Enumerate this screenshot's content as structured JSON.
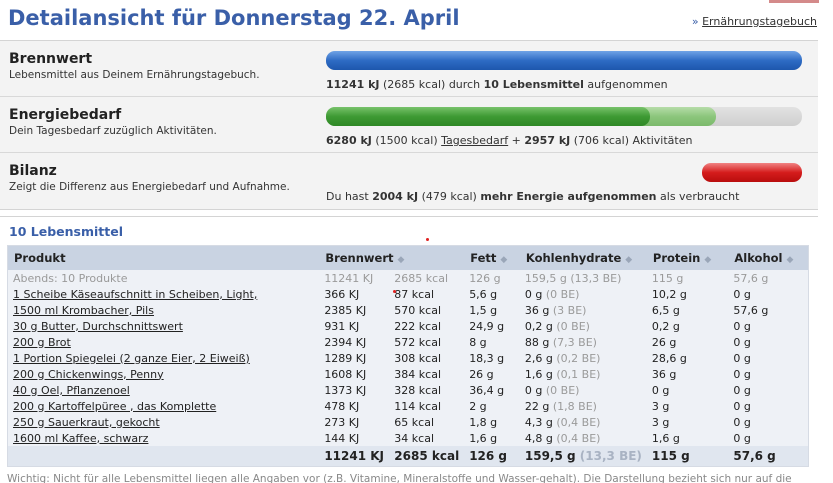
{
  "header": {
    "title": "Detailansicht für Donnerstag 22. April",
    "link_prefix": "»",
    "link_label": "Ernährungstagebuch"
  },
  "summary": {
    "brennwert": {
      "title": "Brennwert",
      "subtitle": "Lebensmittel aus Deinem Ernährungstagebuch.",
      "kj": "11241 kJ",
      "kcal": "(2685 kcal)",
      "mid": "durch",
      "count": "10 Lebensmittel",
      "suffix": "aufgenommen",
      "fill_percent": 100
    },
    "energiebedarf": {
      "title": "Energiebedarf",
      "subtitle": "Dein Tagesbedarf zuzüglich Aktivitäten.",
      "kj1": "6280 kJ",
      "kcal1": "(1500 kcal)",
      "link": "Tagesbedarf",
      "plus": "+",
      "kj2": "2957 kJ",
      "kcal2": "(706 kcal)",
      "suffix": "Aktivitäten",
      "fill_percent": 82,
      "dark_percent": 68
    },
    "bilanz": {
      "title": "Bilanz",
      "subtitle": "Zeigt die Differenz aus Energiebedarf und Aufnahme.",
      "prefix": "Du hast",
      "kj": "2004 kJ",
      "kcal": "(479 kcal)",
      "bold": "mehr Energie aufgenommen",
      "suffix": "als verbraucht",
      "fill_percent": 21
    }
  },
  "colors": {
    "title_blue": "#3a5fa8",
    "bar_blue": "#2e6bc4",
    "bar_green": "#3e9a33",
    "bar_red": "#d51c1c",
    "table_header": "#c9d3e2"
  },
  "list": {
    "title": "10 Lebensmittel",
    "columns": {
      "produkt": "Produkt",
      "brennwert": "Brennwert",
      "fett": "Fett",
      "kohlenhydrate": "Kohlenhydrate",
      "protein": "Protein",
      "alkohol": "Alkohol"
    },
    "group": {
      "name": "Abends: 10 Produkte",
      "kj": "11241 KJ",
      "kcal": "2685 kcal",
      "fett": "126 g",
      "kh": "159,5 g (13,3 BE)",
      "protein": "115 g",
      "alkohol": "57,6 g"
    },
    "rows": [
      {
        "name": "1 Scheibe Käseaufschnitt in Scheiben, Light,",
        "kj": "366 KJ",
        "kcal": "87 kcal",
        "fett": "5,6 g",
        "kh": "0 g",
        "be": "(0 BE)",
        "protein": "10,2 g",
        "alkohol": "0 g"
      },
      {
        "name": "1500 ml Krombacher, Pils",
        "kj": "2385 KJ",
        "kcal": "570 kcal",
        "fett": "1,5 g",
        "kh": "36 g",
        "be": "(3 BE)",
        "protein": "6,5 g",
        "alkohol": "57,6 g"
      },
      {
        "name": "30 g Butter, Durchschnittswert",
        "kj": "931 KJ",
        "kcal": "222 kcal",
        "fett": "24,9 g",
        "kh": "0,2 g",
        "be": "(0 BE)",
        "protein": "0,2 g",
        "alkohol": "0 g"
      },
      {
        "name": "200 g Brot",
        "kj": "2394 KJ",
        "kcal": "572 kcal",
        "fett": "8 g",
        "kh": "88 g",
        "be": "(7,3 BE)",
        "protein": "26 g",
        "alkohol": "0 g"
      },
      {
        "name": "1 Portion Spiegelei (2 ganze Eier, 2 Eiweiß)",
        "kj": "1289 KJ",
        "kcal": "308 kcal",
        "fett": "18,3 g",
        "kh": "2,6 g",
        "be": "(0,2 BE)",
        "protein": "28,6 g",
        "alkohol": "0 g"
      },
      {
        "name": "200 g Chickenwings, Penny",
        "kj": "1608 KJ",
        "kcal": "384 kcal",
        "fett": "26 g",
        "kh": "1,6 g",
        "be": "(0,1 BE)",
        "protein": "36 g",
        "alkohol": "0 g"
      },
      {
        "name": "40 g Oel, Pflanzenoel",
        "kj": "1373 KJ",
        "kcal": "328 kcal",
        "fett": "36,4 g",
        "kh": "0 g",
        "be": "(0 BE)",
        "protein": "0 g",
        "alkohol": "0 g"
      },
      {
        "name": "200 g Kartoffelpüree , das Komplette",
        "kj": "478 KJ",
        "kcal": "114 kcal",
        "fett": "2 g",
        "kh": "22 g",
        "be": "(1,8 BE)",
        "protein": "3 g",
        "alkohol": "0 g"
      },
      {
        "name": "250 g Sauerkraut, gekocht",
        "kj": "273 KJ",
        "kcal": "65 kcal",
        "fett": "1,8 g",
        "kh": "4,3 g",
        "be": "(0,4 BE)",
        "protein": "3 g",
        "alkohol": "0 g"
      },
      {
        "name": "1600 ml Kaffee, schwarz",
        "kj": "144 KJ",
        "kcal": "34 kcal",
        "fett": "1,6 g",
        "kh": "4,8 g",
        "be": "(0,4 BE)",
        "protein": "1,6 g",
        "alkohol": "0 g"
      }
    ],
    "total": {
      "kj": "11241 KJ",
      "kcal": "2685 kcal",
      "fett": "126 g",
      "kh": "159,5 g",
      "be": "(13,3 BE)",
      "protein": "115 g",
      "alkohol": "57,6 g"
    }
  },
  "footnote": "Wichtig: Nicht für alle Lebensmittel liegen alle Angaben vor (z.B. Vitamine, Mineralstoffe und Wasser-gehalt). Die Darstellung bezieht sich nur auf die"
}
